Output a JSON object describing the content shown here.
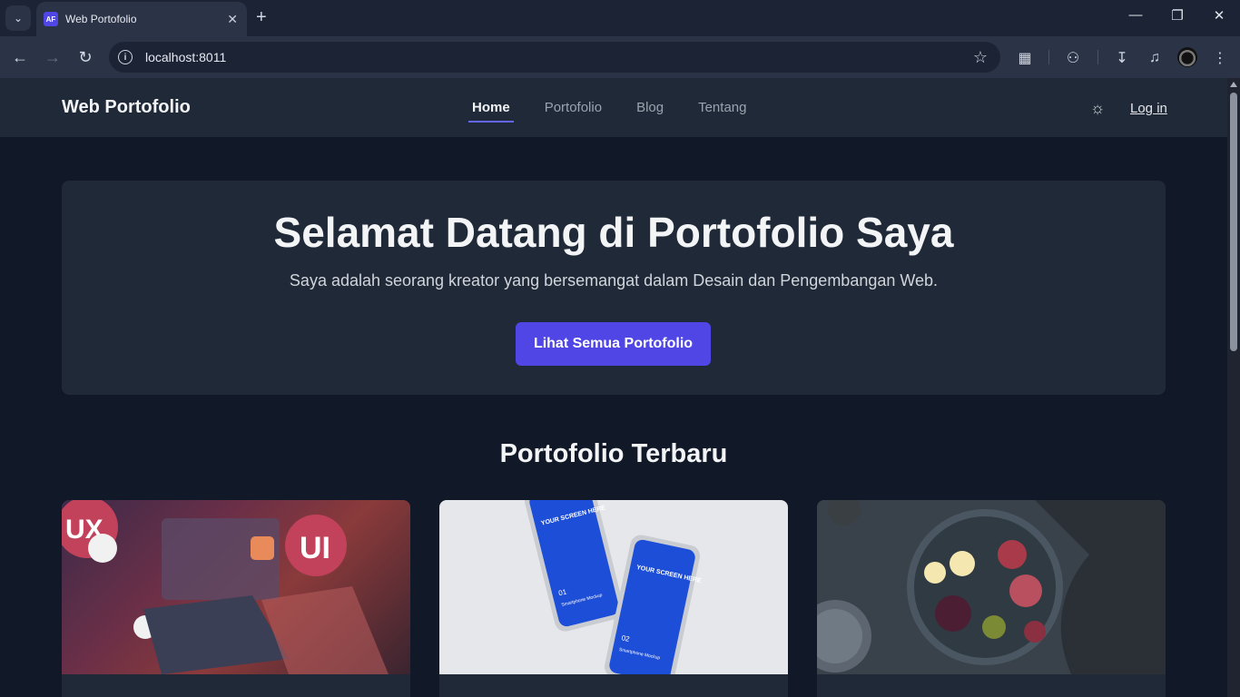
{
  "browser": {
    "tab_title": "Web Portofolio",
    "favicon_text": "AF",
    "url": "localhost:8011"
  },
  "site": {
    "brand": "Web Portofolio",
    "nav": [
      {
        "label": "Home",
        "active": true
      },
      {
        "label": "Portofolio",
        "active": false
      },
      {
        "label": "Blog",
        "active": false
      },
      {
        "label": "Tentang",
        "active": false
      }
    ],
    "login_label": "Log in"
  },
  "hero": {
    "title": "Selamat Datang di Portofolio Saya",
    "subtitle": "Saya adalah seorang kreator yang bersemangat dalam Desain dan Pengembangan Web.",
    "button_label": "Lihat Semua Portofolio"
  },
  "latest": {
    "title": "Portofolio Terbaru",
    "cards": [
      {
        "image": "ux-ui-laptop-illustration",
        "image_text": [
          "UX",
          "UI"
        ]
      },
      {
        "image": "smartphone-mockup",
        "image_text": [
          "YOUR SCREEN HERE",
          "01",
          "Smartphone Mockup",
          "YOUR SCREEN HERE",
          "02",
          "Smartphone Mockup"
        ]
      },
      {
        "image": "food-platter-photo",
        "image_text": []
      }
    ]
  },
  "colors": {
    "accent": "#4f46e5",
    "page_bg": "#111827",
    "panel_bg": "#1f2937"
  }
}
